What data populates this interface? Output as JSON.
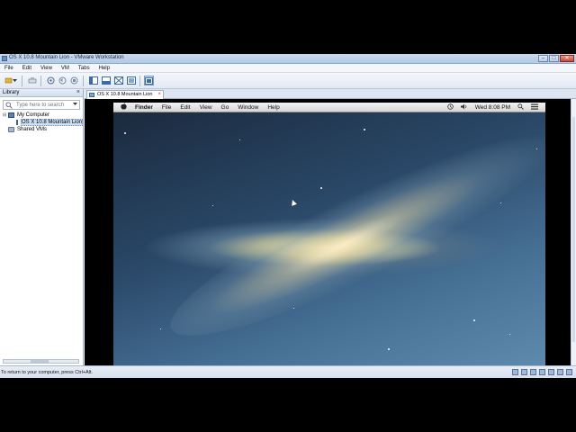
{
  "window": {
    "title": "OS X 10.8 Mountain Lion - VMware Workstation",
    "controls": {
      "minimize": "–",
      "maximize": "□",
      "close": "✕"
    }
  },
  "menubar": [
    "File",
    "Edit",
    "View",
    "VM",
    "Tabs",
    "Help"
  ],
  "toolbar": {
    "icons": [
      "power-icon",
      "dropdown-icon",
      "send-ctrl-alt-del-icon",
      "snapshot-take-icon",
      "snapshot-revert-icon",
      "snapshot-manager-icon",
      "view-library-icon",
      "view-console-icon",
      "fullscreen-icon",
      "unity-icon",
      "stretch-icon"
    ]
  },
  "library": {
    "title": "Library",
    "close": "×",
    "search_placeholder": "Type here to search",
    "tree": {
      "expander": "⊟",
      "my_computer": "My Computer",
      "vm_item": "OS X 10.8 Mountain Lion",
      "shared": "Shared VMs"
    }
  },
  "tab": {
    "label": "OS X 10.8 Mountain Lion",
    "close": "×"
  },
  "guest": {
    "menus": [
      "Finder",
      "File",
      "Edit",
      "View",
      "Go",
      "Window",
      "Help"
    ],
    "clock": "Wed 8:08 PM"
  },
  "status": {
    "message": "To return to your computer, press Ctrl+Alt."
  },
  "colors": {
    "chrome": "#e9eef6",
    "titlebar": "#b3c9e5",
    "desktop_dark": "#1b2a3e",
    "desktop_light": "#5e8aae"
  }
}
